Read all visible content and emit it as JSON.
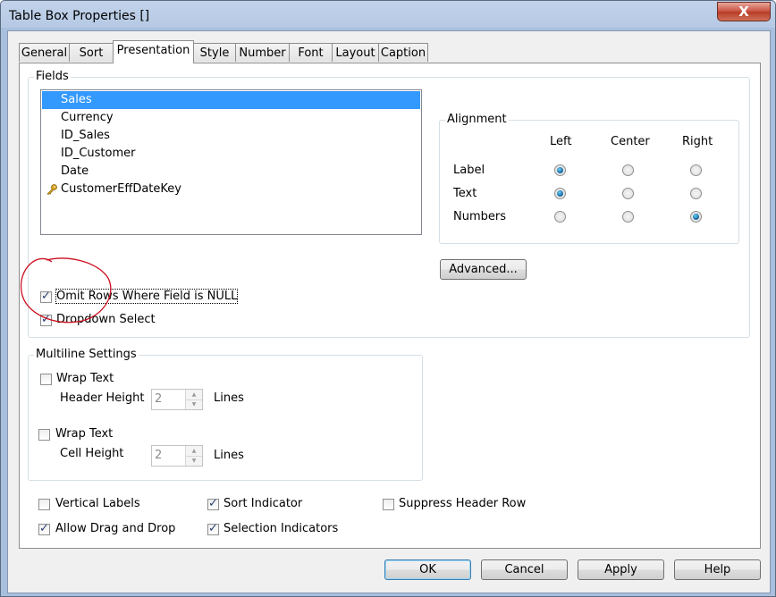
{
  "window": {
    "title": "Table Box Properties []",
    "close_glyph": "X"
  },
  "tabs": [
    "General",
    "Sort",
    "Presentation",
    "Style",
    "Number",
    "Font",
    "Layout",
    "Caption"
  ],
  "fields": {
    "label": "Fields",
    "items": [
      "Sales",
      "Currency",
      "ID_Sales",
      "ID_Customer",
      "Date",
      "CustomerEffDateKey"
    ],
    "selected": "Sales"
  },
  "alignment": {
    "label": "Alignment",
    "columns": [
      "Left",
      "Center",
      "Right"
    ],
    "rows": [
      {
        "label": "Label",
        "selected": "Left"
      },
      {
        "label": "Text",
        "selected": "Left"
      },
      {
        "label": "Numbers",
        "selected": "Right"
      }
    ]
  },
  "advanced_button": "Advanced...",
  "omit_rows": {
    "label": "Omit Rows Where Field is NULL",
    "checked": true
  },
  "dropdown_select": {
    "label": "Dropdown Select",
    "checked": true
  },
  "multiline": {
    "label": "Multiline Settings",
    "header_wrap": {
      "label": "Wrap Text",
      "checked": false
    },
    "header_height_label": "Header Height",
    "header_height_value": "2",
    "header_lines": "Lines",
    "cell_wrap": {
      "label": "Wrap Text",
      "checked": false
    },
    "cell_height_label": "Cell Height",
    "cell_height_value": "2",
    "cell_lines": "Lines"
  },
  "options": {
    "vertical_labels": {
      "label": "Vertical Labels",
      "checked": false
    },
    "allow_drag": {
      "label": "Allow Drag and Drop",
      "checked": true
    },
    "sort_indicator": {
      "label": "Sort Indicator",
      "checked": true
    },
    "selection_indicators": {
      "label": "Selection Indicators",
      "checked": true
    },
    "suppress_header": {
      "label": "Suppress Header Row",
      "checked": false
    }
  },
  "buttons": {
    "ok": "OK",
    "cancel": "Cancel",
    "apply": "Apply",
    "help": "Help"
  },
  "colors": {
    "selection": "#3399ff",
    "annotation": "#cc1122",
    "title_bar": "#b6c9e4",
    "close_red": "#c9513f"
  }
}
